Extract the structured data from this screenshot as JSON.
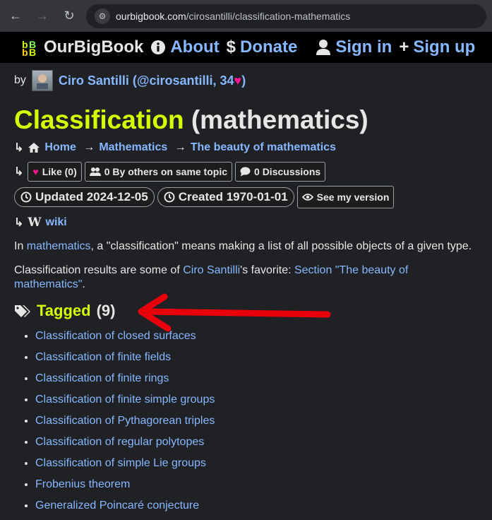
{
  "browser": {
    "url_host": "ourbigbook.com",
    "url_path": "/cirosantilli/classification-mathematics"
  },
  "header": {
    "logo_text": "OurBigBook",
    "about": "About",
    "donate": "Donate",
    "sign_in": "Sign in",
    "sign_up": "Sign up"
  },
  "byline": {
    "by": "by",
    "author": "Ciro Santilli (@cirosantilli, 34",
    "author_end": ")"
  },
  "article": {
    "title_main": "Classification",
    "title_paren": "(mathematics)",
    "breadcrumbs": [
      "Home",
      "Mathematics",
      "The beauty of mathematics"
    ],
    "like": "Like (0)",
    "others": "0 By others on same topic",
    "discussions": "0 Discussions",
    "updated": "Updated 2024-12-05",
    "created": "Created 1970-01-01",
    "see_version": "See my version",
    "wiki": "wiki",
    "p1_pre": "In ",
    "p1_link": "mathematics",
    "p1_post": ", a \"classification\" means making a list of all possible objects of a given type.",
    "p2_pre": "Classification results are some of ",
    "p2_link1": "Ciro Santilli",
    "p2_mid": "'s favorite: ",
    "p2_link2": "Section \"The beauty of mathematics\"",
    "p2_post": "."
  },
  "tagged": {
    "label": "Tagged",
    "count": "(9)",
    "items": [
      "Classification of closed surfaces",
      "Classification of finite fields",
      "Classification of finite rings",
      "Classification of finite simple groups",
      "Classification of Pythagorean triples",
      "Classification of regular polytopes",
      "Classification of simple Lie groups",
      "Frobenius theorem",
      "Generalized Poincaré conjecture"
    ]
  },
  "colors": {
    "title": "#d4ff00",
    "link": "#87b7ff",
    "heart": "#ff1493",
    "annotation_arrow": "#e8000b"
  }
}
